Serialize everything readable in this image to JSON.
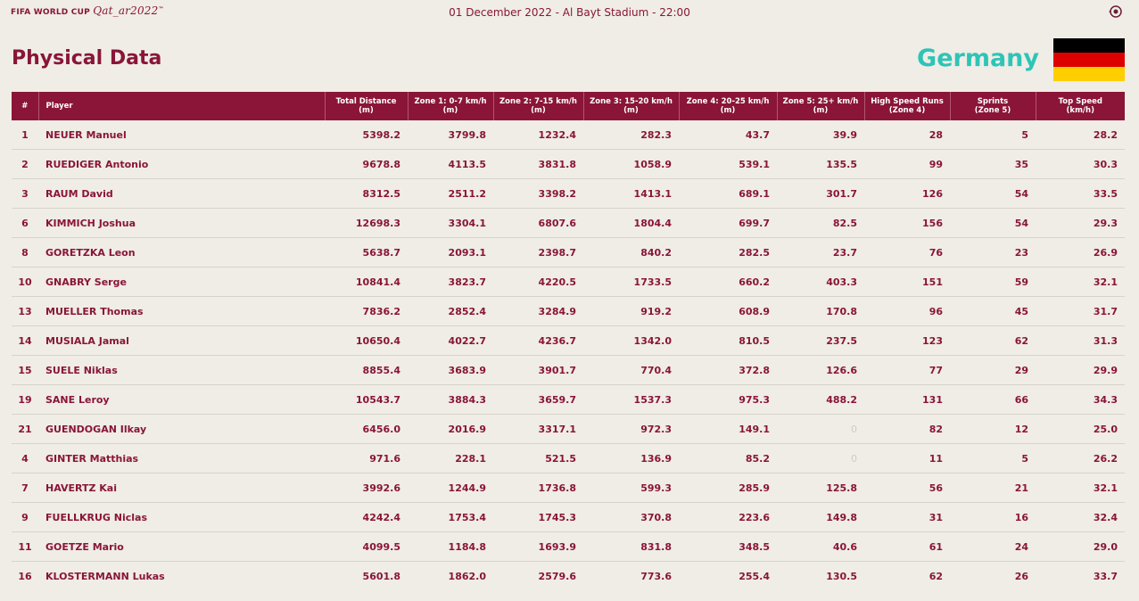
{
  "header": {
    "brand_fifa": "FIFA WORLD CUP",
    "brand_qatar": "Qat_ar2022",
    "brand_tm": "™",
    "match_info": "01 December 2022 - Al Bayt Stadium - 22:00",
    "icon": "settings-globe-icon"
  },
  "page_title": "Physical Data",
  "team": {
    "name": "Germany",
    "flag_colors": [
      "#000000",
      "#dd0000",
      "#ffce00"
    ]
  },
  "colors": {
    "accent": "#8a1538",
    "team": "#2ec4b6",
    "background": "#efede6"
  },
  "table": {
    "columns": [
      {
        "line1": "#",
        "line2": ""
      },
      {
        "line1": "Player",
        "line2": ""
      },
      {
        "line1": "Total Distance",
        "line2": "(m)"
      },
      {
        "line1": "Zone 1: 0-7 km/h",
        "line2": "(m)"
      },
      {
        "line1": "Zone 2: 7-15 km/h",
        "line2": "(m)"
      },
      {
        "line1": "Zone 3: 15-20 km/h",
        "line2": "(m)"
      },
      {
        "line1": "Zone 4: 20-25 km/h",
        "line2": "(m)"
      },
      {
        "line1": "Zone 5: 25+ km/h",
        "line2": "(m)"
      },
      {
        "line1": "High Speed Runs",
        "line2": "(Zone 4)"
      },
      {
        "line1": "Sprints",
        "line2": "(Zone 5)"
      },
      {
        "line1": "Top Speed",
        "line2": "(km/h)"
      }
    ],
    "rows": [
      [
        "1",
        "NEUER Manuel",
        "5398.2",
        "3799.8",
        "1232.4",
        "282.3",
        "43.7",
        "39.9",
        "28",
        "5",
        "28.2"
      ],
      [
        "2",
        "RUEDIGER Antonio",
        "9678.8",
        "4113.5",
        "3831.8",
        "1058.9",
        "539.1",
        "135.5",
        "99",
        "35",
        "30.3"
      ],
      [
        "3",
        "RAUM David",
        "8312.5",
        "2511.2",
        "3398.2",
        "1413.1",
        "689.1",
        "301.7",
        "126",
        "54",
        "33.5"
      ],
      [
        "6",
        "KIMMICH Joshua",
        "12698.3",
        "3304.1",
        "6807.6",
        "1804.4",
        "699.7",
        "82.5",
        "156",
        "54",
        "29.3"
      ],
      [
        "8",
        "GORETZKA Leon",
        "5638.7",
        "2093.1",
        "2398.7",
        "840.2",
        "282.5",
        "23.7",
        "76",
        "23",
        "26.9"
      ],
      [
        "10",
        "GNABRY Serge",
        "10841.4",
        "3823.7",
        "4220.5",
        "1733.5",
        "660.2",
        "403.3",
        "151",
        "59",
        "32.1"
      ],
      [
        "13",
        "MUELLER Thomas",
        "7836.2",
        "2852.4",
        "3284.9",
        "919.2",
        "608.9",
        "170.8",
        "96",
        "45",
        "31.7"
      ],
      [
        "14",
        "MUSIALA Jamal",
        "10650.4",
        "4022.7",
        "4236.7",
        "1342.0",
        "810.5",
        "237.5",
        "123",
        "62",
        "31.3"
      ],
      [
        "15",
        "SUELE Niklas",
        "8855.4",
        "3683.9",
        "3901.7",
        "770.4",
        "372.8",
        "126.6",
        "77",
        "29",
        "29.9"
      ],
      [
        "19",
        "SANE Leroy",
        "10543.7",
        "3884.3",
        "3659.7",
        "1537.3",
        "975.3",
        "488.2",
        "131",
        "66",
        "34.3"
      ],
      [
        "21",
        "GUENDOGAN Ilkay",
        "6456.0",
        "2016.9",
        "3317.1",
        "972.3",
        "149.1",
        "0",
        "82",
        "12",
        "25.0"
      ],
      [
        "4",
        "GINTER Matthias",
        "971.6",
        "228.1",
        "521.5",
        "136.9",
        "85.2",
        "0",
        "11",
        "5",
        "26.2"
      ],
      [
        "7",
        "HAVERTZ Kai",
        "3992.6",
        "1244.9",
        "1736.8",
        "599.3",
        "285.9",
        "125.8",
        "56",
        "21",
        "32.1"
      ],
      [
        "9",
        "FUELLKRUG Niclas",
        "4242.4",
        "1753.4",
        "1745.3",
        "370.8",
        "223.6",
        "149.8",
        "31",
        "16",
        "32.4"
      ],
      [
        "11",
        "GOETZE Mario",
        "4099.5",
        "1184.8",
        "1693.9",
        "831.8",
        "348.5",
        "40.6",
        "61",
        "24",
        "29.0"
      ],
      [
        "16",
        "KLOSTERMANN Lukas",
        "5601.8",
        "1862.0",
        "2579.6",
        "773.6",
        "255.4",
        "130.5",
        "62",
        "26",
        "33.7"
      ]
    ]
  }
}
